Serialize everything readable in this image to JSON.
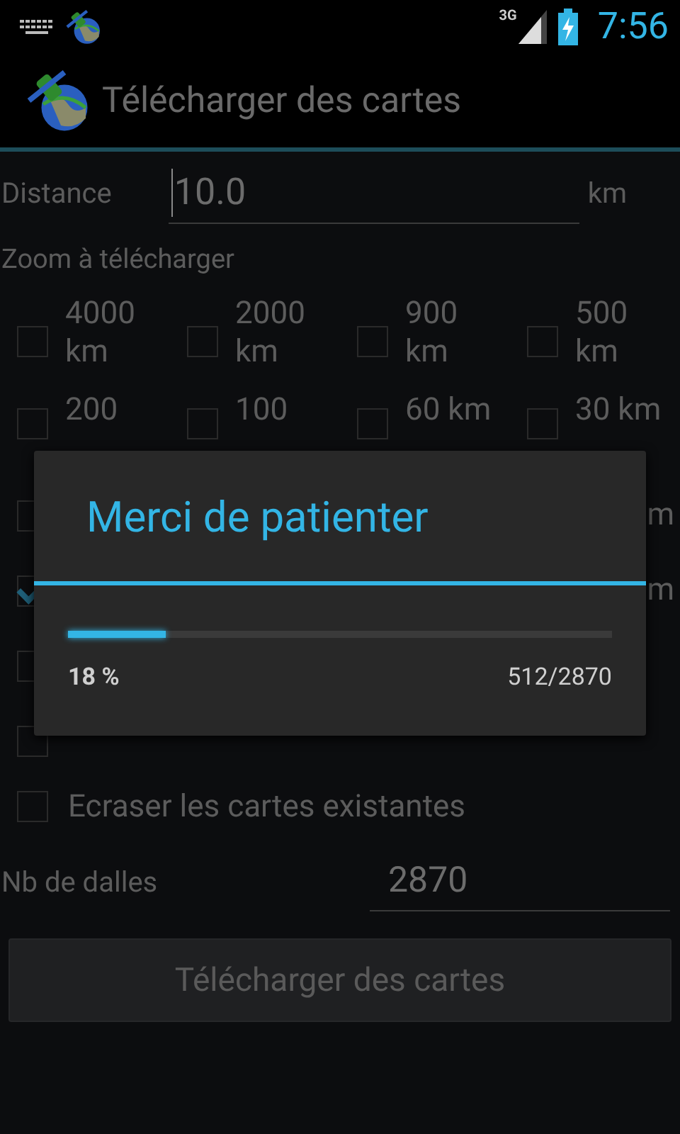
{
  "status_bar": {
    "network": "3G",
    "time": "7:56"
  },
  "action_bar": {
    "title": "Télécharger des cartes"
  },
  "distance": {
    "label": "Distance",
    "value": "10.0",
    "unit": "km"
  },
  "zoom_section": {
    "label": "Zoom à télécharger"
  },
  "zoom_rows": [
    [
      {
        "kind": "checkbox",
        "checked": false,
        "label": "4000 km"
      },
      {
        "kind": "checkbox",
        "checked": false,
        "label": "2000 km"
      },
      {
        "kind": "checkbox",
        "checked": false,
        "label": "900 km"
      },
      {
        "kind": "checkbox",
        "checked": false,
        "label": "500 km"
      }
    ],
    [
      {
        "kind": "checkbox",
        "checked": false,
        "label": "200"
      },
      {
        "kind": "checkbox",
        "checked": false,
        "label": "100"
      },
      {
        "kind": "checkbox",
        "checked": false,
        "label": "60 km"
      },
      {
        "kind": "checkbox",
        "checked": false,
        "label": "30 km"
      }
    ],
    [
      {
        "kind": "checkbox",
        "checked": false
      },
      {
        "kind": "empty"
      },
      {
        "kind": "empty"
      },
      {
        "kind": "fragment",
        "label": "m"
      }
    ],
    [
      {
        "kind": "checkbox",
        "checked": true
      },
      {
        "kind": "empty"
      },
      {
        "kind": "empty"
      },
      {
        "kind": "fragment",
        "label": "m"
      }
    ],
    [
      {
        "kind": "checkbox",
        "checked": false
      },
      {
        "kind": "empty"
      },
      {
        "kind": "empty"
      },
      {
        "kind": "empty"
      }
    ],
    [
      {
        "kind": "checkbox",
        "checked": false
      },
      {
        "kind": "empty"
      },
      {
        "kind": "empty"
      },
      {
        "kind": "empty"
      }
    ]
  ],
  "overwrite": {
    "label": "Ecraser les cartes existantes",
    "checked": false
  },
  "tiles": {
    "label": "Nb de dalles",
    "value": "2870"
  },
  "download_button": {
    "label": "Télécharger des cartes",
    "disabled": true
  },
  "dialog": {
    "title": "Merci de patienter",
    "level": 0.18,
    "percent": "18 %",
    "count": "512/2870"
  }
}
